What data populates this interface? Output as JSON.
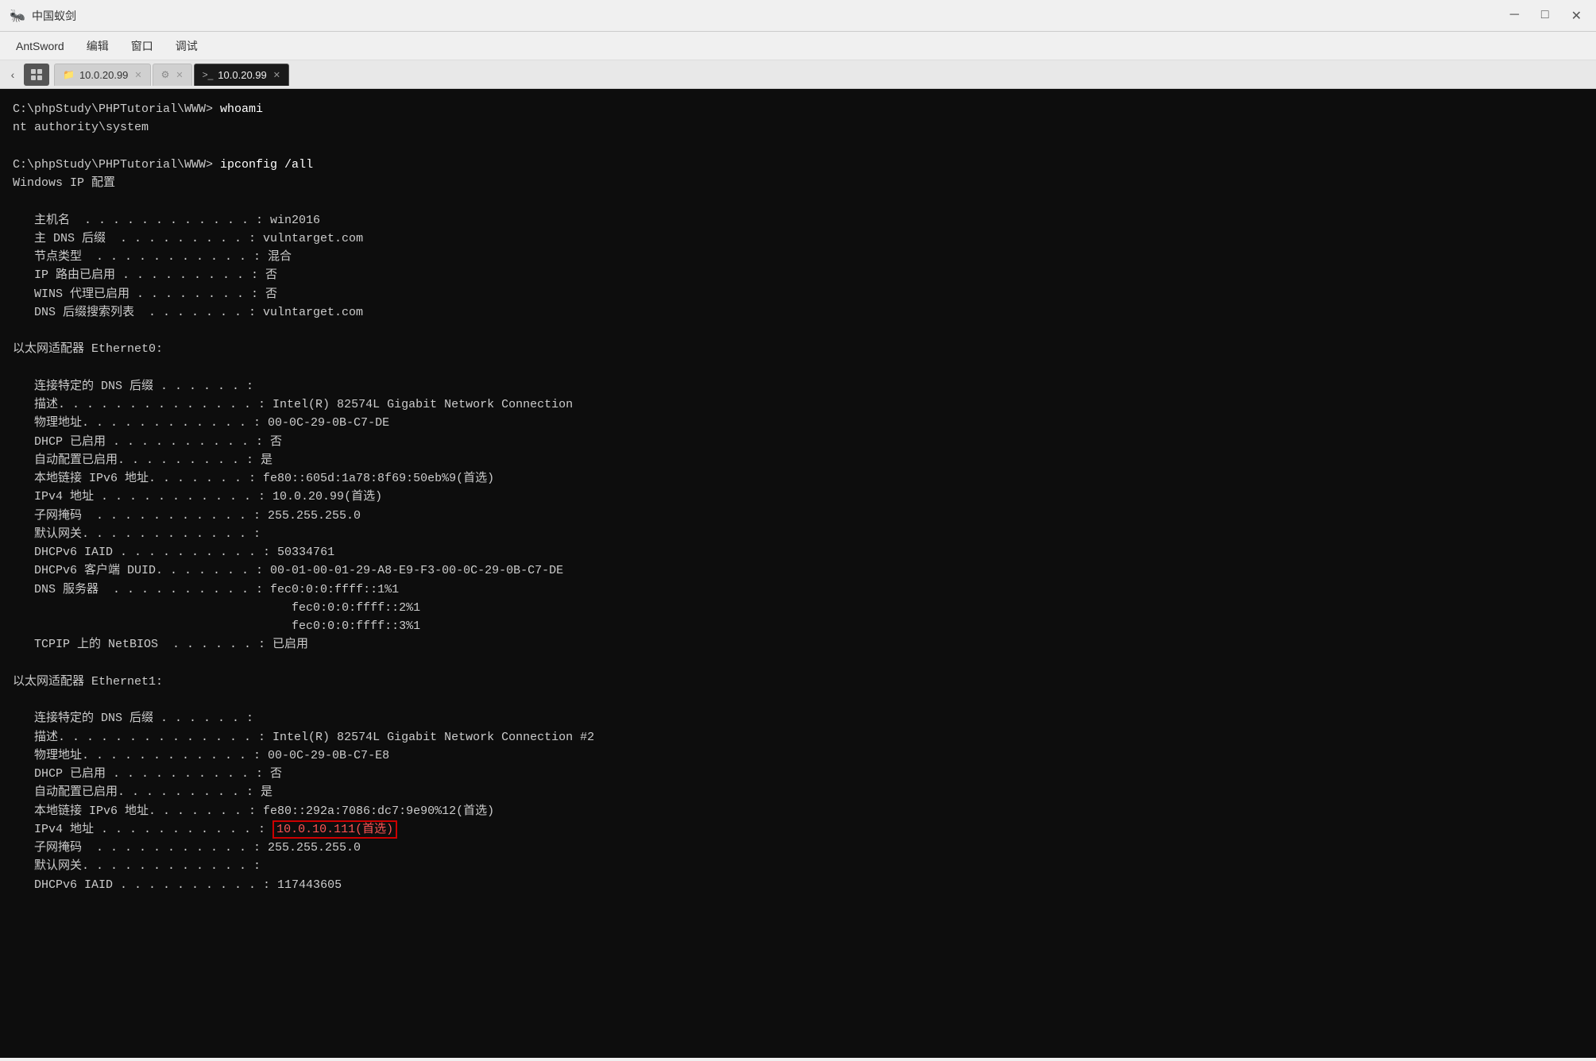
{
  "titlebar": {
    "icon": "🐜",
    "title": "中国蚁剑",
    "min_btn": "─",
    "max_btn": "□",
    "close_btn": "✕"
  },
  "menubar": {
    "items": [
      "AntSword",
      "编辑",
      "窗口",
      "调试"
    ]
  },
  "tabbar": {
    "tabs": [
      {
        "id": "tab-file",
        "icon": "📁",
        "label": "10.0.20.99",
        "active": false
      },
      {
        "id": "tab-settings",
        "icon": "⚙",
        "label": "",
        "active": false
      },
      {
        "id": "tab-terminal",
        "icon": ">_",
        "label": "10.0.20.99",
        "active": true
      }
    ]
  },
  "terminal": {
    "lines": [
      "C:\\phpStudy\\PHPTutorial\\WWW> whoami",
      "nt authority\\system",
      "",
      "C:\\phpStudy\\PHPTutorial\\WWW> ipconfig /all",
      "Windows IP 配置",
      "",
      "   主机名  . . . . . . . . . . . . : win2016",
      "   主 DNS 后缀  . . . . . . . . . : vulntarget.com",
      "   节点类型  . . . . . . . . . . . : 混合",
      "   IP 路由已启用 . . . . . . . . . : 否",
      "   WINS 代理已启用 . . . . . . . . : 否",
      "   DNS 后缀搜索列表  . . . . . . . : vulntarget.com",
      "",
      "以太网适配器 Ethernet0:",
      "",
      "   连接特定的 DNS 后缀 . . . . . . :",
      "   描述. . . . . . . . . . . . . . : Intel(R) 82574L Gigabit Network Connection",
      "   物理地址. . . . . . . . . . . . : 00-0C-29-0B-C7-DE",
      "   DHCP 已启用 . . . . . . . . . . : 否",
      "   自动配置已启用. . . . . . . . . : 是",
      "   本地链接 IPv6 地址. . . . . . . : fe80::605d:1a78:8f69:50eb%9(首选)",
      "   IPv4 地址 . . . . . . . . . . . : 10.0.20.99(首选)",
      "   子网掩码  . . . . . . . . . . . : 255.255.255.0",
      "   默认网关. . . . . . . . . . . . :",
      "   DHCPv6 IAID . . . . . . . . . . : 50334761",
      "   DHCPv6 客户端 DUID. . . . . . . : 00-01-00-01-29-A8-E9-F3-00-0C-29-0B-C7-DE",
      "   DNS 服务器  . . . . . . . . . . : fec0:0:0:ffff::1%1",
      "                                       fec0:0:0:ffff::2%1",
      "                                       fec0:0:0:ffff::3%1",
      "   TCPIP 上的 NetBIOS  . . . . . . : 已启用",
      "",
      "以太网适配器 Ethernet1:",
      "",
      "   连接特定的 DNS 后缀 . . . . . . :",
      "   描述. . . . . . . . . . . . . . : Intel(R) 82574L Gigabit Network Connection #2",
      "   物理地址. . . . . . . . . . . . : 00-0C-29-0B-C7-E8",
      "   DHCP 已启用 . . . . . . . . . . : 否",
      "   自动配置已启用. . . . . . . . . : 是",
      "   本地链接 IPv6 地址. . . . . . . : fe80::292a:7086:dc7:9e90%12(首选)",
      "   IPv4 地址 . . . . . . . . . . . : HIGHLIGHT:10.0.10.111(首选)",
      "   子网掩码  . . . . . . . . . . . : 255.255.255.0",
      "   默认网关. . . . . . . . . . . . :",
      "   DHCPv6 IAID . . . . . . . . . . : 117443605"
    ],
    "highlight_line_index": 39,
    "highlight_prefix": "   IPv4 地址 . . . . . . . . . . . : ",
    "highlight_value": "10.0.10.111(首选)"
  }
}
